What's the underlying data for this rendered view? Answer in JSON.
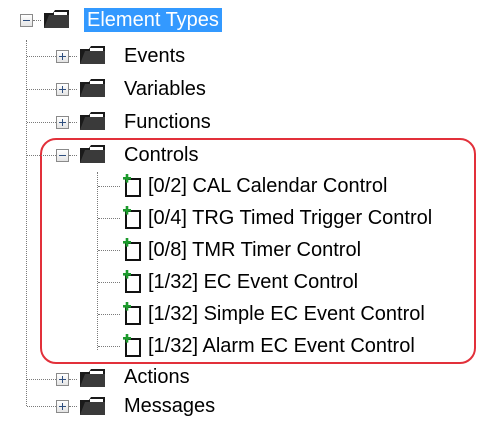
{
  "tree": {
    "root": {
      "label": "Element Types",
      "icon": "folder-icon",
      "expanded": true,
      "selected": true
    },
    "children": [
      {
        "label": "Events",
        "icon": "folder-icon",
        "expanded": false
      },
      {
        "label": "Variables",
        "icon": "folder-icon",
        "expanded": false
      },
      {
        "label": "Functions",
        "icon": "folder-icon",
        "expanded": false
      },
      {
        "label": "Controls",
        "icon": "folder-icon",
        "expanded": true,
        "children": [
          {
            "label": "[0/2] CAL Calendar Control",
            "icon": "new-item-icon"
          },
          {
            "label": "[0/4] TRG Timed Trigger Control",
            "icon": "new-item-icon"
          },
          {
            "label": "[0/8] TMR Timer Control",
            "icon": "new-item-icon"
          },
          {
            "label": "[1/32] EC Event Control",
            "icon": "new-item-icon"
          },
          {
            "label": "[1/32] Simple EC Event Control",
            "icon": "new-item-icon"
          },
          {
            "label": "[1/32] Alarm EC Event Control",
            "icon": "new-item-icon"
          }
        ]
      },
      {
        "label": "Actions",
        "icon": "folder-icon",
        "expanded": false
      },
      {
        "label": "Messages",
        "icon": "folder-icon",
        "expanded": false
      }
    ]
  },
  "colors": {
    "selection": "#3399ff",
    "highlight_outline": "#e2303a",
    "leaf_plus": "#1c9a2c"
  }
}
